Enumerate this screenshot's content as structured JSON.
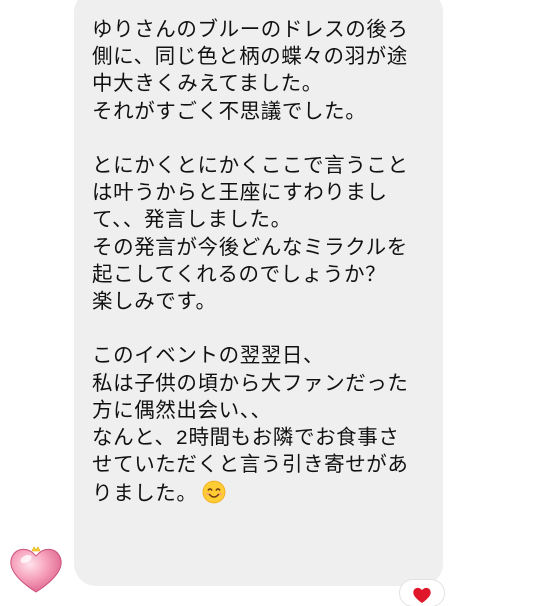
{
  "message": {
    "lines": [
      "ゆりさんのブルーのドレスの後ろ",
      "側に、同じ色と柄の蝶々の羽が途",
      "中大きくみえてました。",
      "それがすごく不思議でした。",
      "",
      "とにかくとにかくここで言うこと",
      "は叶うからと王座にすわりまし",
      "て、、発言しました。",
      "その発言が今後どんなミラクルを",
      "起こしてくれるのでしょうか？",
      "楽しみです。",
      "",
      "このイベントの翌翌日、",
      "私は子供の頃から大ファンだった",
      "方に偶然出会い、、",
      "なんと、2時間もお隣でお食事さ",
      "せていただくと言う引き寄せがあ",
      "りました。"
    ],
    "trailing_emoji": "smiling-face-emoji"
  },
  "avatar": {
    "icon": "pink-heart-sticker-icon"
  },
  "reaction": {
    "icon": "red-heart-icon",
    "color": "#e0162b"
  },
  "colors": {
    "bubble": "#efeff0",
    "text": "#111111",
    "background": "#ffffff"
  }
}
